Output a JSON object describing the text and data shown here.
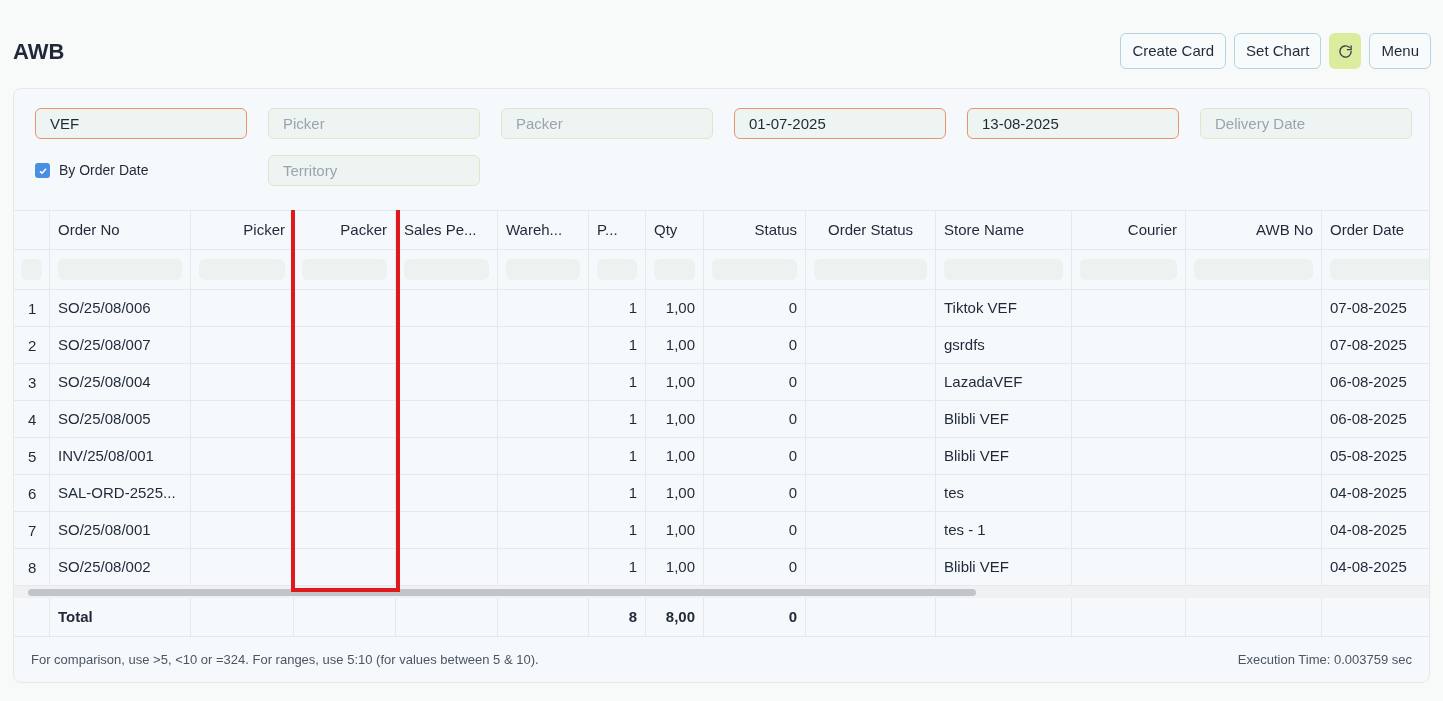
{
  "title": "AWB",
  "actions": [
    {
      "kind": "text",
      "label": "Create Card"
    },
    {
      "kind": "text",
      "label": "Set Chart"
    },
    {
      "kind": "refresh"
    },
    {
      "kind": "text",
      "label": "Menu"
    }
  ],
  "filters": [
    {
      "value": "VEF",
      "required": true
    },
    {
      "placeholder": "Picker",
      "required": false
    },
    {
      "placeholder": "Packer",
      "required": false
    },
    {
      "value": "01-07-2025",
      "required": true
    },
    {
      "value": "13-08-2025",
      "required": true
    },
    {
      "placeholder": "Delivery Date",
      "required": false
    }
  ],
  "checkbox": {
    "label": "By Order Date",
    "checked": true
  },
  "filters_row2": [
    {
      "placeholder": "Territory",
      "required": false
    }
  ],
  "columns": [
    {
      "label": "Order No",
      "highlighted": false
    },
    {
      "label": "Picker",
      "highlighted": false
    },
    {
      "label": "Packer",
      "highlighted": true
    },
    {
      "label": "Sales Pe...",
      "highlighted": false
    },
    {
      "label": "Wareh...",
      "highlighted": false
    },
    {
      "label": "P...",
      "highlighted": false
    },
    {
      "label": "Qty",
      "highlighted": false
    },
    {
      "label": "Status",
      "highlighted": false
    },
    {
      "label": "Order Status",
      "highlighted": false
    },
    {
      "label": "Store Name",
      "highlighted": false
    },
    {
      "label": "Courier",
      "highlighted": false
    },
    {
      "label": "AWB No",
      "highlighted": false
    },
    {
      "label": "Order Date",
      "highlighted": false
    }
  ],
  "rows": [
    {
      "no": "1",
      "order_no": "SO/25/08/006",
      "p": "1",
      "qty": "1,00",
      "status": "0",
      "store_name": "Tiktok VEF",
      "order_date": "07-08-2025"
    },
    {
      "no": "2",
      "order_no": "SO/25/08/007",
      "p": "1",
      "qty": "1,00",
      "status": "0",
      "store_name": "gsrdfs",
      "order_date": "07-08-2025"
    },
    {
      "no": "3",
      "order_no": "SO/25/08/004",
      "p": "1",
      "qty": "1,00",
      "status": "0",
      "store_name": "LazadaVEF",
      "order_date": "06-08-2025"
    },
    {
      "no": "4",
      "order_no": "SO/25/08/005",
      "p": "1",
      "qty": "1,00",
      "status": "0",
      "store_name": "Blibli VEF",
      "order_date": "06-08-2025"
    },
    {
      "no": "5",
      "order_no": "INV/25/08/001",
      "p": "1",
      "qty": "1,00",
      "status": "0",
      "store_name": "Blibli VEF",
      "order_date": "05-08-2025"
    },
    {
      "no": "6",
      "order_no": "SAL-ORD-2525...",
      "p": "1",
      "qty": "1,00",
      "status": "0",
      "store_name": "tes",
      "order_date": "04-08-2025"
    },
    {
      "no": "7",
      "order_no": "SO/25/08/001",
      "p": "1",
      "qty": "1,00",
      "status": "0",
      "store_name": "tes - 1",
      "order_date": "04-08-2025"
    },
    {
      "no": "8",
      "order_no": "SO/25/08/002",
      "p": "1",
      "qty": "1,00",
      "status": "0",
      "store_name": "Blibli VEF",
      "order_date": "04-08-2025"
    }
  ],
  "total": {
    "order_no": "Total",
    "p": "8",
    "qty": "8,00",
    "status": "0"
  },
  "footer": {
    "hint": "For comparison, use >5, <10 or =324. For ranges, use 5:10 (for values between 5 & 10).",
    "execution_time": "Execution Time: 0.003759 sec"
  }
}
